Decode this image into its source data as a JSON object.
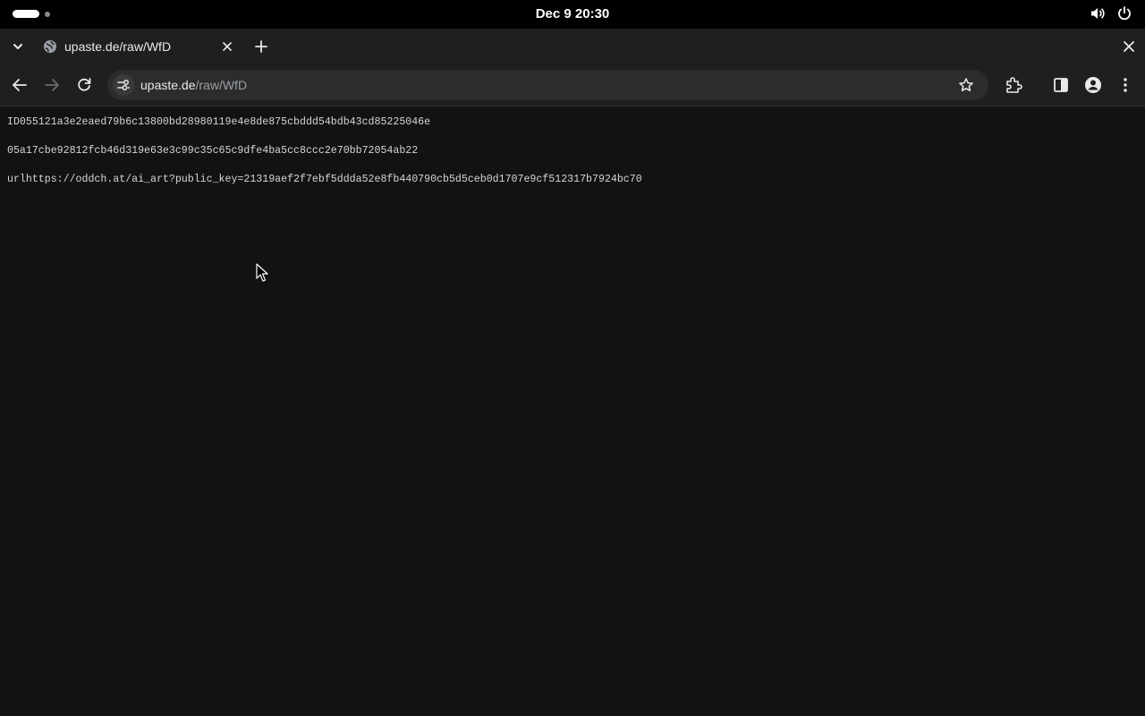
{
  "system_bar": {
    "clock": "Dec 9  20:30",
    "icons": [
      "activities-indicator",
      "volume-icon",
      "power-icon"
    ]
  },
  "browser": {
    "tabs": [
      {
        "title": "upaste.de/raw/WfD",
        "favicon": "globe-icon",
        "active": true
      }
    ],
    "address_bar": {
      "host": "upaste.de",
      "path": "/raw/WfD"
    },
    "toolbar_icons": [
      "back-arrow-icon",
      "forward-arrow-icon",
      "reload-icon",
      "site-info-icon",
      "bookmark-star-icon",
      "extensions-icon",
      "side-panel-icon",
      "profile-icon",
      "menu-icon"
    ]
  },
  "page": {
    "lines": [
      "ID055121a3e2eaed79b6c13800bd28980119e4e8de875cbddd54bdb43cd85225046e",
      "05a17cbe92812fcb46d319e63e3c99c35c65c9dfe4ba5cc8ccc2e70bb72054ab22",
      "urlhttps://oddch.at/ai_art?public_key=21319aef2f7ebf5ddda52e8fb440790cb5d5ceb0d1707e9cf512317b7924bc70"
    ]
  },
  "colors": {
    "page_bg": "#121212",
    "chrome_bg": "#1f1f1f",
    "omnibox_bg": "#2c2c2c",
    "text": "#d6d6d6",
    "url_path": "#9aa0a6"
  }
}
